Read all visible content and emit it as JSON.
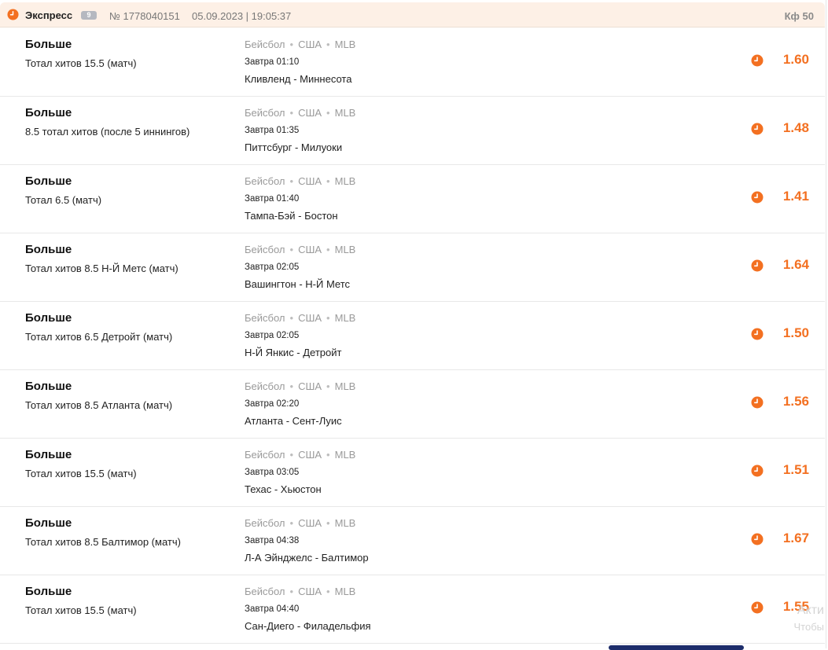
{
  "header": {
    "type": "Экспресс",
    "badge": "9",
    "number": "№ 1778040151",
    "datetime": "05.09.2023 | 19:05:37",
    "coef": "Кф 50"
  },
  "accent_color": "#f37021",
  "bets": [
    {
      "type": "Больше",
      "detail": "Тотал хитов 15.5 (матч)",
      "sport": "Бейсбол",
      "country": "США",
      "league": "MLB",
      "time": "Завтра 01:10",
      "teams": "Кливленд - Миннесота",
      "odds": "1.60"
    },
    {
      "type": "Больше",
      "detail": "8.5 тотал хитов (после 5 иннингов)",
      "sport": "Бейсбол",
      "country": "США",
      "league": "MLB",
      "time": "Завтра 01:35",
      "teams": "Питтсбург - Милуоки",
      "odds": "1.48"
    },
    {
      "type": "Больше",
      "detail": "Тотал 6.5 (матч)",
      "sport": "Бейсбол",
      "country": "США",
      "league": "MLB",
      "time": "Завтра 01:40",
      "teams": "Тампа-Бэй - Бостон",
      "odds": "1.41"
    },
    {
      "type": "Больше",
      "detail": "Тотал хитов 8.5 Н-Й Метс (матч)",
      "sport": "Бейсбол",
      "country": "США",
      "league": "MLB",
      "time": "Завтра 02:05",
      "teams": "Вашингтон - Н-Й Метс",
      "odds": "1.64"
    },
    {
      "type": "Больше",
      "detail": "Тотал хитов 6.5 Детройт (матч)",
      "sport": "Бейсбол",
      "country": "США",
      "league": "MLB",
      "time": "Завтра 02:05",
      "teams": "Н-Й Янкис - Детройт",
      "odds": "1.50"
    },
    {
      "type": "Больше",
      "detail": "Тотал хитов 8.5 Атланта (матч)",
      "sport": "Бейсбол",
      "country": "США",
      "league": "MLB",
      "time": "Завтра 02:20",
      "teams": "Атланта - Сент-Луис",
      "odds": "1.56"
    },
    {
      "type": "Больше",
      "detail": "Тотал хитов 15.5 (матч)",
      "sport": "Бейсбол",
      "country": "США",
      "league": "MLB",
      "time": "Завтра 03:05",
      "teams": "Техас - Хьюстон",
      "odds": "1.51"
    },
    {
      "type": "Больше",
      "detail": "Тотал хитов 8.5 Балтимор (матч)",
      "sport": "Бейсбол",
      "country": "США",
      "league": "MLB",
      "time": "Завтра 04:38",
      "teams": "Л-А Эйнджелс - Балтимор",
      "odds": "1.67"
    },
    {
      "type": "Больше",
      "detail": "Тотал хитов 15.5 (матч)",
      "sport": "Бейсбол",
      "country": "США",
      "league": "MLB",
      "time": "Завтра 04:40",
      "teams": "Сан-Диего - Филадельфия",
      "odds": "1.55"
    }
  ],
  "watermark": {
    "line1": "Акти",
    "line2": "Чтобы"
  }
}
